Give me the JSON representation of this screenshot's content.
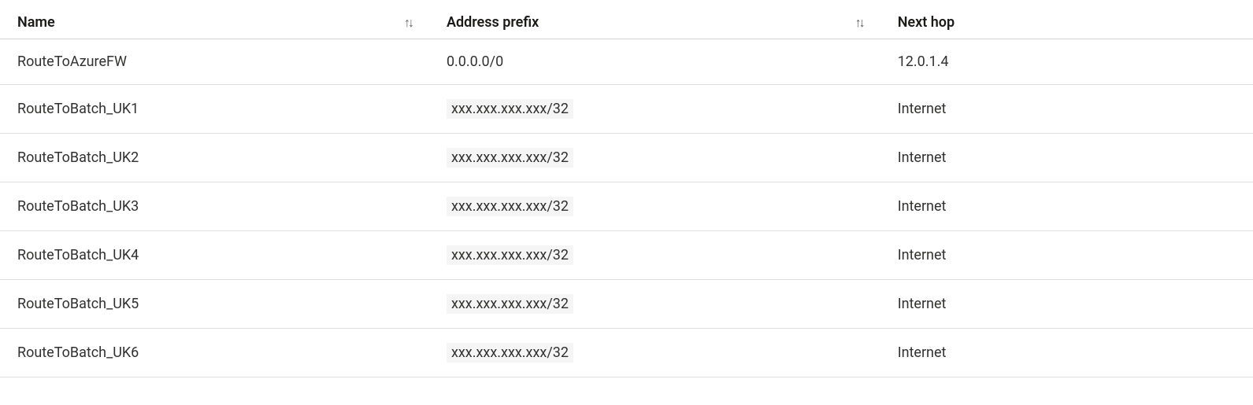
{
  "table": {
    "columns": {
      "name": "Name",
      "address": "Address prefix",
      "nexthop": "Next hop"
    },
    "sort_glyph": "↑↓",
    "rows": [
      {
        "name": "RouteToAzureFW",
        "address": "0.0.0.0/0",
        "address_masked": false,
        "nexthop": "12.0.1.4"
      },
      {
        "name": "RouteToBatch_UK1",
        "address": "xxx.xxx.xxx.xxx/32",
        "address_masked": true,
        "nexthop": "Internet"
      },
      {
        "name": "RouteToBatch_UK2",
        "address": "xxx.xxx.xxx.xxx/32",
        "address_masked": true,
        "nexthop": "Internet"
      },
      {
        "name": "RouteToBatch_UK3",
        "address": "xxx.xxx.xxx.xxx/32",
        "address_masked": true,
        "nexthop": "Internet"
      },
      {
        "name": "RouteToBatch_UK4",
        "address": "xxx.xxx.xxx.xxx/32",
        "address_masked": true,
        "nexthop": "Internet"
      },
      {
        "name": "RouteToBatch_UK5",
        "address": "xxx.xxx.xxx.xxx/32",
        "address_masked": true,
        "nexthop": "Internet"
      },
      {
        "name": "RouteToBatch_UK6",
        "address": "xxx.xxx.xxx.xxx/32",
        "address_masked": true,
        "nexthop": "Internet"
      }
    ]
  }
}
